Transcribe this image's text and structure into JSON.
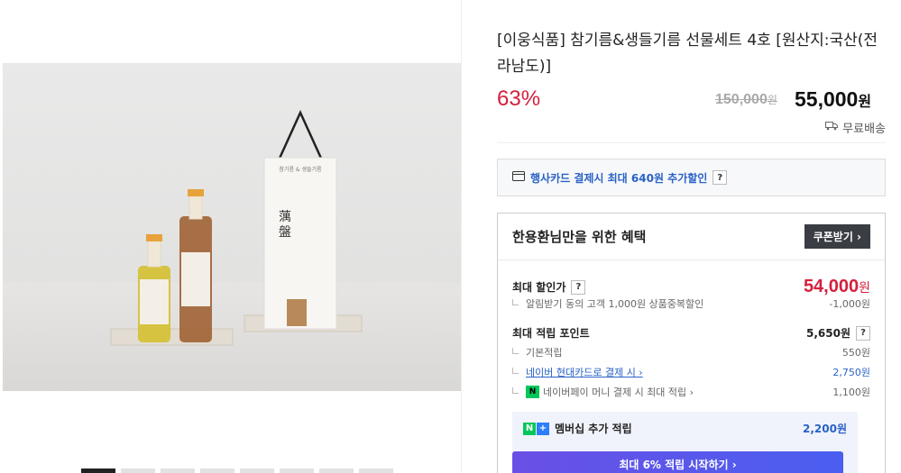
{
  "product": {
    "title": "[이웅식품] 참기름&생들기름 선물세트 4호 [원산지:국산(전라남도)]",
    "discount": "63%",
    "original_price": "150,000",
    "original_won": "원",
    "sale_price": "55,000",
    "sale_won": "원",
    "shipping": "무료배송"
  },
  "card_discount": {
    "text": "행사카드 결제시 최대 640원 추가할인",
    "help": "?"
  },
  "benefit": {
    "title": "한용환님만을 위한 혜택",
    "coupon_button": "쿠폰받기 ›",
    "max_discount_label": "최대 할인가",
    "max_discount_value": "54,000",
    "max_discount_won": "원",
    "alarm_text": "알림받기 동의 고객 1,000원 상품중복할인",
    "alarm_value": "-1,000원",
    "points_label": "최대 적립 포인트",
    "points_value": "5,650원",
    "basic_label": "기본적립",
    "basic_value": "550원",
    "hyundai_label": "네이버 현대카드로 결제 시 ›",
    "hyundai_value": "2,750원",
    "npay_label": "네이버페이 머니 결제 시 최대 적립 ›",
    "npay_value": "1,100원",
    "membership_label": "멤버십 추가 적립",
    "membership_value": "2,200원",
    "start_button": "최대 6% 적립 시작하기 ›"
  },
  "colors": {
    "accent_red": "#d4203d",
    "accent_blue": "#2962c6",
    "naver_green": "#03c75a"
  }
}
